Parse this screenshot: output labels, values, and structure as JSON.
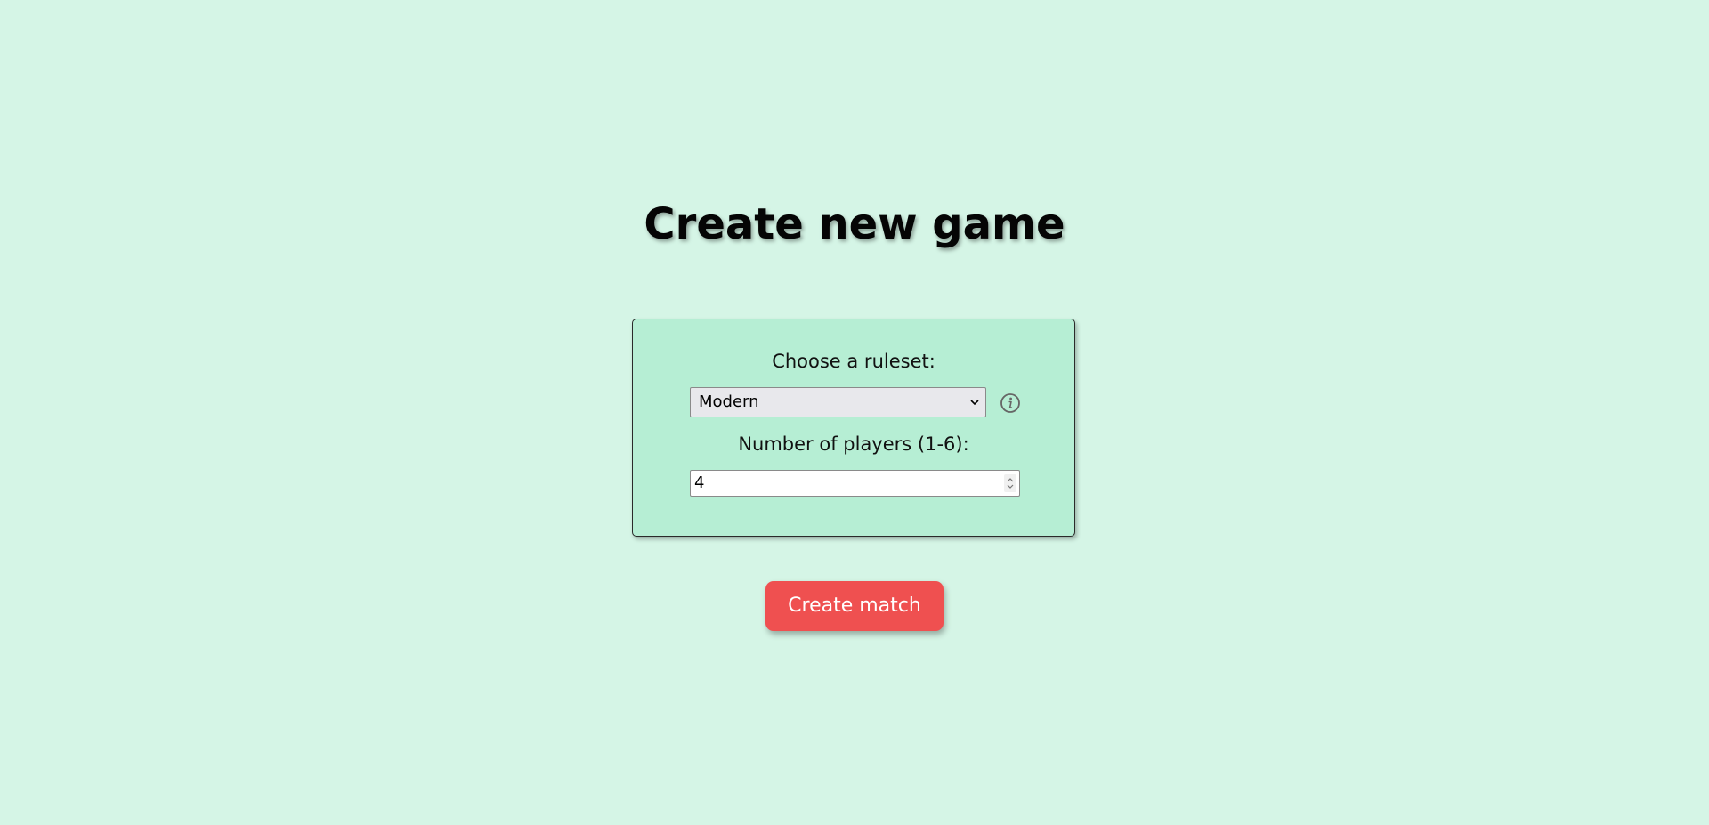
{
  "page": {
    "title": "Create new game"
  },
  "form": {
    "ruleset_label": "Choose a ruleset:",
    "ruleset_selected": "Modern",
    "players_label": "Number of players (1-6):",
    "players_value": "4"
  },
  "actions": {
    "create_label": "Create match"
  },
  "icons": {
    "info": "info-icon",
    "dropdown": "chevron-down-icon",
    "spinner": "spinner-icon"
  },
  "colors": {
    "background": "#d5f5e6",
    "panel": "#b6eed4",
    "button": "#ef5050"
  }
}
